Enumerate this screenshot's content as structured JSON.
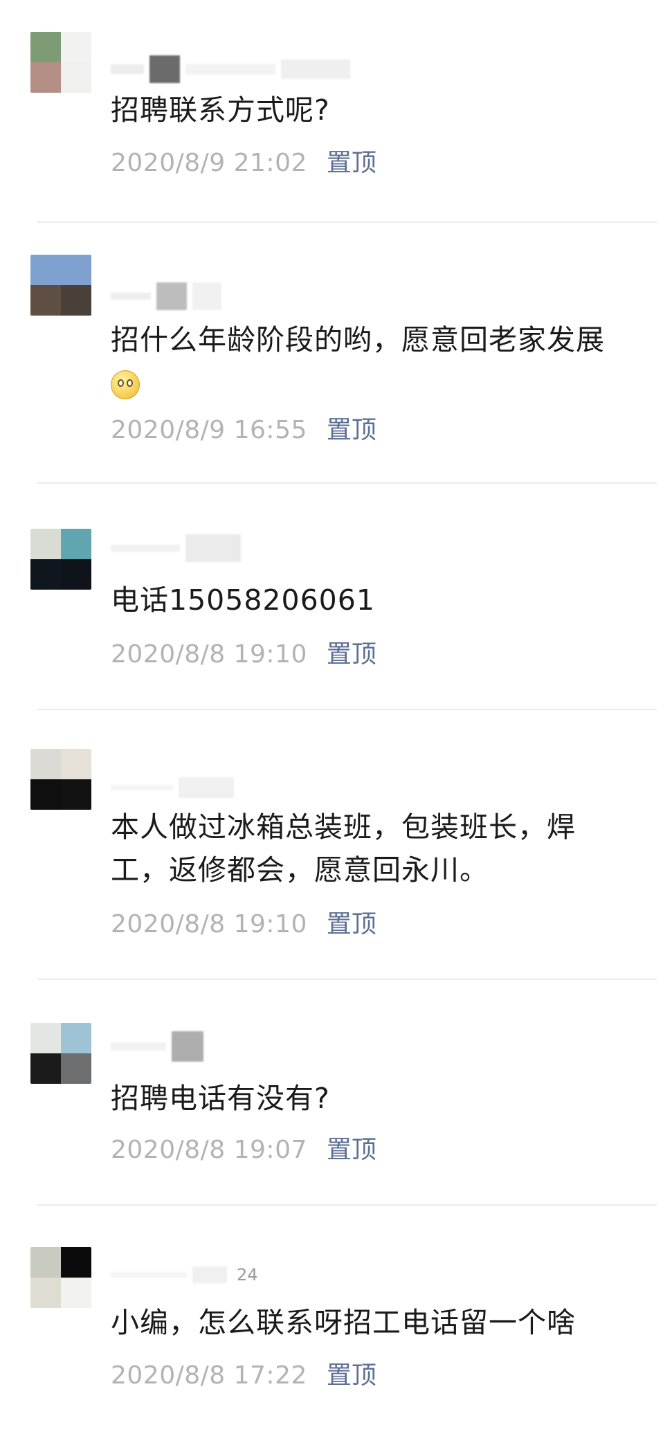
{
  "comments": [
    {
      "text": "招聘联系方式呢?",
      "timestamp": "2020/8/9 21:02",
      "pin_label": "置顶",
      "avatar_colors": [
        "#7d9c76",
        "#f2f2f0",
        "#b58f86",
        "#f0f0ee"
      ],
      "name_colors": [
        "#ececec",
        "#6b6b6b",
        "#f3f3f3",
        "#efefef"
      ]
    },
    {
      "text": "招什么年龄阶段的哟，愿意回老家发展",
      "emoji": "smile-emoji",
      "timestamp": "2020/8/9 16:55",
      "pin_label": "置顶",
      "avatar_colors": [
        "#7ea1cf",
        "#7ea1cf",
        "#5e4f42",
        "#4b4038"
      ],
      "name_colors": [
        "#eeeeee",
        "#bdbdbd",
        "#f1f1f1"
      ]
    },
    {
      "text": "电话15058206061",
      "timestamp": "2020/8/8 19:10",
      "pin_label": "置顶",
      "avatar_colors": [
        "#d9dcd4",
        "#5fa6b1",
        "#10161d",
        "#0f141a"
      ],
      "name_colors": [
        "#f1f1f1",
        "#ebebeb"
      ]
    },
    {
      "text": "本人做过冰箱总装班，包装班长，焊工，返修都会，愿意回永川。",
      "timestamp": "2020/8/8 19:10",
      "pin_label": "置顶",
      "avatar_colors": [
        "#dcdad5",
        "#e5e1d9",
        "#0f0f10",
        "#121212"
      ],
      "name_colors": [
        "#f5f5f5",
        "#f0f0f0"
      ]
    },
    {
      "text": "招聘电话有没有?",
      "timestamp": "2020/8/8 19:07",
      "pin_label": "置顶",
      "avatar_colors": [
        "#e4e6e3",
        "#9ec3d4",
        "#1b1b1b",
        "#6d6e6f"
      ],
      "name_colors": [
        "#f2f2f2",
        "#aeaeae"
      ]
    },
    {
      "text": "小编，怎么联系呀招工电话留一个啥",
      "timestamp": "2020/8/8 17:22",
      "pin_label": "置顶",
      "like_count": "24",
      "avatar_colors": [
        "#c9cbc0",
        "#0b0b0b",
        "#dfddd2",
        "#f2f2ee"
      ],
      "name_colors": [
        "#f4f4f4",
        "#f0f0f0"
      ]
    }
  ]
}
